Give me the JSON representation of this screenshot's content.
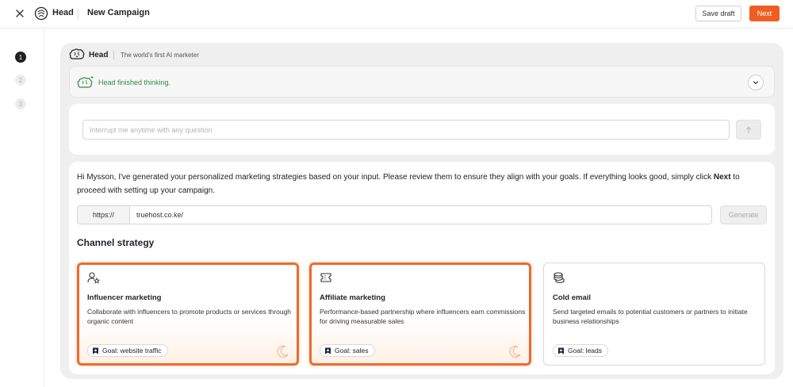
{
  "header": {
    "app_name": "Head",
    "page_title": "New Campaign",
    "save_draft_label": "Save draft",
    "next_label": "Next"
  },
  "steps": [
    "1",
    "2",
    "3"
  ],
  "assistant": {
    "name": "Head",
    "tagline": "The world's first AI marketer",
    "thinking_status": "Head finished thinking.",
    "thinking_color": "#2e8b3d"
  },
  "ask": {
    "placeholder": "Interrupt me anytime with any question"
  },
  "intro": {
    "part1": "Hi Mysson, I've generated your personalized marketing strategies based on your input. Please review them to ensure they align with your goals. If everything looks good, simply click",
    "next_word": "Next",
    "part2": "to proceed with setting up your campaign."
  },
  "url": {
    "prefix": "https://",
    "value": "truehost.co.ke/",
    "generate_label": "Generate"
  },
  "channel_strategy": {
    "title": "Channel strategy",
    "cards": [
      {
        "title": "Influencer marketing",
        "description": "Collaborate with influencers to promote products or services through organic content",
        "goal": "Goal: website traffic",
        "selected": true,
        "icon": "user-star-icon"
      },
      {
        "title": "Affiliate marketing",
        "description": "Performance-based partnership where influencers earn commissions for driving measurable sales",
        "goal": "Goal: sales",
        "selected": true,
        "icon": "ticket-icon"
      },
      {
        "title": "Cold email",
        "description": "Send targeted emails to potential customers or partners to initiate business relationships",
        "goal": "Goal: leads",
        "selected": false,
        "icon": "coins-icon"
      }
    ]
  },
  "colors": {
    "accent": "#ee5e22",
    "selected_border": "#ee6a2c"
  }
}
